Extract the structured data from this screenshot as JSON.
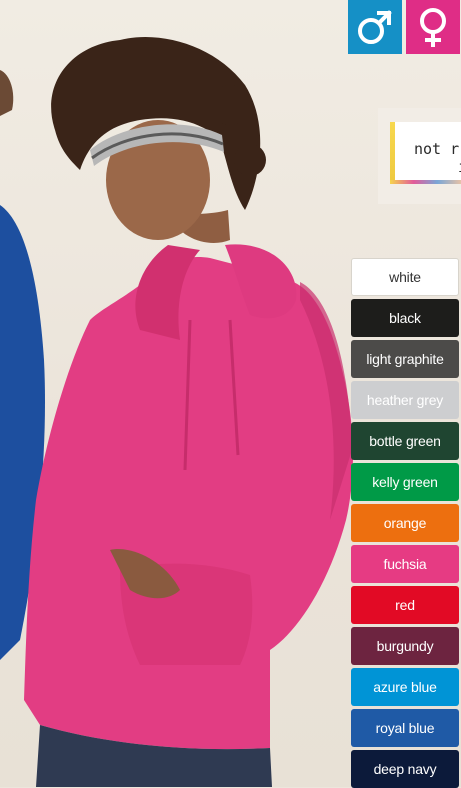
{
  "gender": {
    "male": {
      "icon": "male-symbol-icon",
      "color": "#1590c6"
    },
    "female": {
      "icon": "female-symbol-icon",
      "color": "#df2d86"
    }
  },
  "note": {
    "line1": "not r",
    "line2": "i"
  },
  "colors": [
    {
      "label": "white",
      "hex": "#ffffff",
      "text": "#333333"
    },
    {
      "label": "black",
      "hex": "#1d1d1b",
      "text": "#ffffff"
    },
    {
      "label": "light graphite",
      "hex": "#4c4b49",
      "text": "#ffffff"
    },
    {
      "label": "heather grey",
      "hex": "#cdced0",
      "text": "#ffffff"
    },
    {
      "label": "bottle green",
      "hex": "#1f4531",
      "text": "#ffffff"
    },
    {
      "label": "kelly green",
      "hex": "#009a47",
      "text": "#ffffff"
    },
    {
      "label": "orange",
      "hex": "#ed6f0f",
      "text": "#ffffff"
    },
    {
      "label": "fuchsia",
      "hex": "#e63b83",
      "text": "#ffffff"
    },
    {
      "label": "red",
      "hex": "#e20a25",
      "text": "#ffffff"
    },
    {
      "label": "burgundy",
      "hex": "#6d2440",
      "text": "#ffffff"
    },
    {
      "label": "azure blue",
      "hex": "#0094d6",
      "text": "#ffffff"
    },
    {
      "label": "royal blue",
      "hex": "#1f5aa6",
      "text": "#ffffff"
    },
    {
      "label": "deep navy",
      "hex": "#0c1a3a",
      "text": "#ffffff"
    }
  ]
}
